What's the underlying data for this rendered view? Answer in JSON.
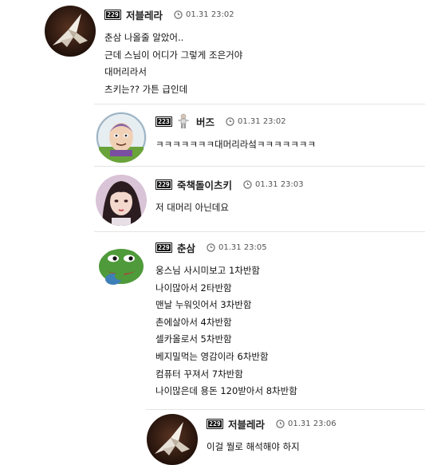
{
  "comments": [
    {
      "level": "229",
      "nickname": "저블레라",
      "date": "01.31 23:02",
      "avatar_icon": "paper-crane-avatar",
      "lines": [
        "춘삼 나올줄 알았어..",
        "근데 스님이 어디가 그렇게 조은거야",
        "대머리라서",
        "츠키는?? 가튼 급인데"
      ]
    },
    {
      "level": "223",
      "nickname": "버즈",
      "date": "01.31 23:02",
      "avatar_icon": "buzz-lightyear-avatar",
      "lines": [
        "ㅋㅋㅋㅋㅋㅋㅋ대머리라섴ㅋㅋㅋㅋㅋㅋㅋ"
      ]
    },
    {
      "level": "229",
      "nickname": "죽책돌이츠키",
      "date": "01.31 23:03",
      "avatar_icon": "girl-portrait-avatar",
      "lines": [
        "저 대머리 아닌데요"
      ]
    },
    {
      "level": "229",
      "nickname": "춘삼",
      "date": "01.31 23:05",
      "avatar_icon": "pepe-frog-avatar",
      "lines": [
        "웅스님 사시미보고 1차반함",
        "나이많아서 2타반함",
        "맨날 누워잇어서 3차반함",
        "촌에살아서 4차반함",
        "셀카올로서 5차반함",
        "베지밀먹는 영감이라 6차반함",
        "컴퓨터 꾸져서 7차반함",
        "나이많은데 용돈 120받아서 8차반함"
      ]
    },
    {
      "level": "229",
      "nickname": "저블레라",
      "date": "01.31 23:06",
      "avatar_icon": "paper-crane-avatar",
      "lines": [
        "이걸 뭘로 해석해야 하지"
      ]
    }
  ]
}
